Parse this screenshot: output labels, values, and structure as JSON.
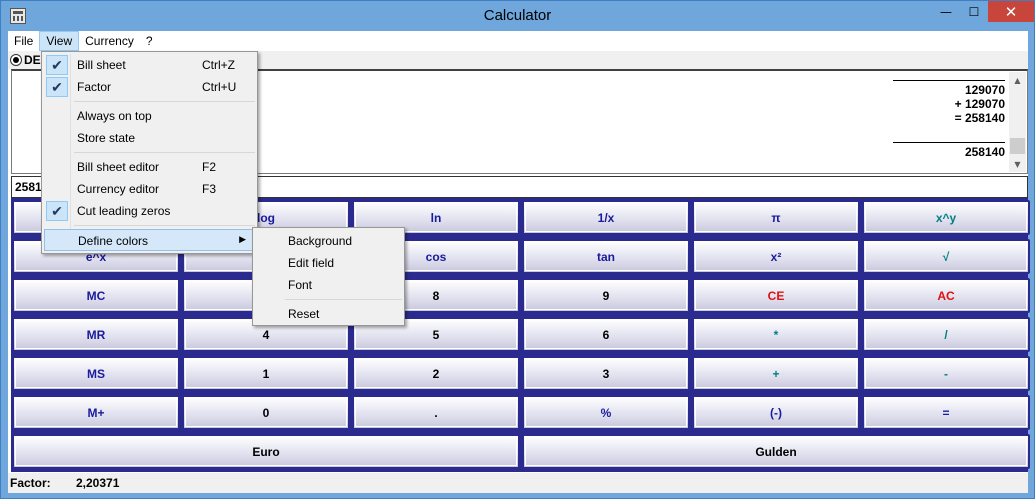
{
  "window": {
    "title": "Calculator",
    "controls": [
      "—",
      "☐",
      "✕"
    ]
  },
  "menubar": {
    "items": [
      "File",
      "View",
      "Currency",
      "?"
    ]
  },
  "mode": {
    "selected": "DEC"
  },
  "sheet": {
    "lines": [
      "129070",
      "+ 129070",
      "= 258140",
      "258140"
    ]
  },
  "edit": {
    "value": "258140"
  },
  "keypad": {
    "rows": [
      [
        {
          "label": "",
          "color": "#1a1a9c"
        },
        {
          "label": "log",
          "color": "#1a1a9c"
        },
        {
          "label": "ln",
          "color": "#1a1a9c"
        },
        {
          "label": "1/x",
          "color": "#1a1a9c"
        },
        {
          "label": "π",
          "color": "#1a1a9c"
        },
        {
          "label": "x^y",
          "color": "#008080"
        }
      ],
      [
        {
          "label": "e^x",
          "color": "#1a1a9c"
        },
        {
          "label": "",
          "color": "#1a1a9c"
        },
        {
          "label": "cos",
          "color": "#1a1a9c"
        },
        {
          "label": "tan",
          "color": "#1a1a9c"
        },
        {
          "label": "x²",
          "color": "#1a1a9c"
        },
        {
          "label": "√",
          "color": "#008080"
        }
      ],
      [
        {
          "label": "MC",
          "color": "#1a1a9c"
        },
        {
          "label": "",
          "color": "#000000"
        },
        {
          "label": "8",
          "color": "#000000"
        },
        {
          "label": "9",
          "color": "#000000"
        },
        {
          "label": "CE",
          "color": "#e01010"
        },
        {
          "label": "AC",
          "color": "#e01010"
        }
      ],
      [
        {
          "label": "MR",
          "color": "#1a1a9c"
        },
        {
          "label": "4",
          "color": "#000000"
        },
        {
          "label": "5",
          "color": "#000000"
        },
        {
          "label": "6",
          "color": "#000000"
        },
        {
          "label": "*",
          "color": "#008080"
        },
        {
          "label": "/",
          "color": "#008080"
        }
      ],
      [
        {
          "label": "MS",
          "color": "#1a1a9c"
        },
        {
          "label": "1",
          "color": "#000000"
        },
        {
          "label": "2",
          "color": "#000000"
        },
        {
          "label": "3",
          "color": "#000000"
        },
        {
          "label": "+",
          "color": "#008080"
        },
        {
          "label": "-",
          "color": "#008080"
        }
      ],
      [
        {
          "label": "M+",
          "color": "#1a1a9c"
        },
        {
          "label": "0",
          "color": "#000000"
        },
        {
          "label": ".",
          "color": "#000000"
        },
        {
          "label": "%",
          "color": "#1a1a9c"
        },
        {
          "label": "(-)",
          "color": "#1a1a9c"
        },
        {
          "label": "=",
          "color": "#1a1a9c"
        }
      ]
    ],
    "wide": [
      {
        "label": "Euro",
        "color": "#000000"
      },
      {
        "label": "Gulden",
        "color": "#000000"
      }
    ]
  },
  "status": {
    "label": "Factor:",
    "value": "2,20371"
  },
  "view_menu": {
    "items": [
      {
        "label": "Bill sheet",
        "shortcut": "Ctrl+Z",
        "checked": true
      },
      {
        "label": "Factor",
        "shortcut": "Ctrl+U",
        "checked": true
      },
      {
        "label": "Always on top",
        "shortcut": "",
        "checked": false
      },
      {
        "label": "Store state",
        "shortcut": "",
        "checked": false
      },
      {
        "label": "Bill sheet editor",
        "shortcut": "F2",
        "checked": false
      },
      {
        "label": "Currency editor",
        "shortcut": "F3",
        "checked": false
      },
      {
        "label": "Cut leading zeros",
        "shortcut": "",
        "checked": true
      },
      {
        "label": "Define colors",
        "shortcut": "",
        "checked": false
      }
    ]
  },
  "colors_submenu": {
    "items": [
      "Background",
      "Edit field",
      "Font",
      "Reset"
    ]
  }
}
